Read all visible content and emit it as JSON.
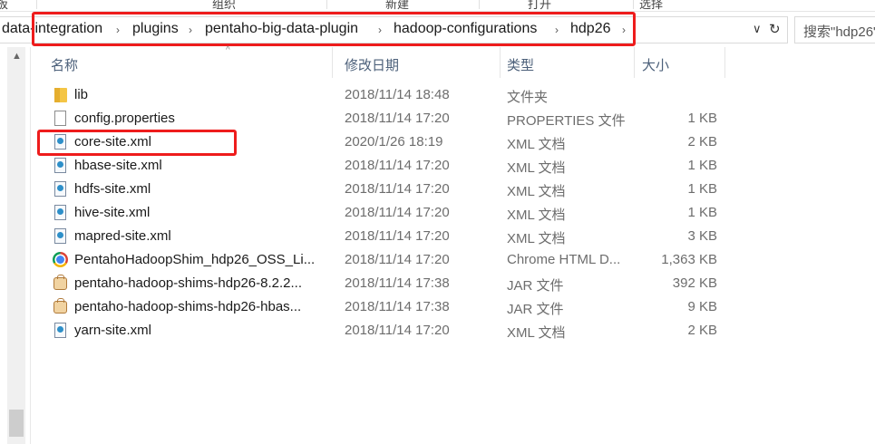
{
  "ribbon": {
    "groups": [
      "板",
      "组织",
      "新建",
      "打开",
      "选择"
    ]
  },
  "address_bar": {
    "breadcrumbs": [
      "data-integration",
      "plugins",
      "pentaho-big-data-plugin",
      "hadoop-configurations",
      "hdp26"
    ],
    "dropdown_icon": "chevron-down-icon",
    "refresh_icon": "refresh-icon"
  },
  "search": {
    "placeholder": "搜索\"hdp26\""
  },
  "columns": {
    "name": "名称",
    "date": "修改日期",
    "type": "类型",
    "size": "大小"
  },
  "files": [
    {
      "name": "lib",
      "date": "2018/11/14 18:48",
      "type": "文件夹",
      "size": "",
      "icon": "folder-icon"
    },
    {
      "name": "config.properties",
      "date": "2018/11/14 17:20",
      "type": "PROPERTIES 文件",
      "size": "1 KB",
      "icon": "document-icon"
    },
    {
      "name": "core-site.xml",
      "date": "2020/1/26 18:19",
      "type": "XML 文档",
      "size": "2 KB",
      "icon": "xml-file-icon"
    },
    {
      "name": "hbase-site.xml",
      "date": "2018/11/14 17:20",
      "type": "XML 文档",
      "size": "1 KB",
      "icon": "xml-file-icon"
    },
    {
      "name": "hdfs-site.xml",
      "date": "2018/11/14 17:20",
      "type": "XML 文档",
      "size": "1 KB",
      "icon": "xml-file-icon"
    },
    {
      "name": "hive-site.xml",
      "date": "2018/11/14 17:20",
      "type": "XML 文档",
      "size": "1 KB",
      "icon": "xml-file-icon"
    },
    {
      "name": "mapred-site.xml",
      "date": "2018/11/14 17:20",
      "type": "XML 文档",
      "size": "3 KB",
      "icon": "xml-file-icon"
    },
    {
      "name": "PentahoHadoopShim_hdp26_OSS_Li...",
      "date": "2018/11/14 17:20",
      "type": "Chrome HTML D...",
      "size": "1,363 KB",
      "icon": "chrome-icon"
    },
    {
      "name": "pentaho-hadoop-shims-hdp26-8.2.2...",
      "date": "2018/11/14 17:38",
      "type": "JAR 文件",
      "size": "392 KB",
      "icon": "jar-icon"
    },
    {
      "name": "pentaho-hadoop-shims-hdp26-hbas...",
      "date": "2018/11/14 17:38",
      "type": "JAR 文件",
      "size": "9 KB",
      "icon": "jar-icon"
    },
    {
      "name": "yarn-site.xml",
      "date": "2018/11/14 17:20",
      "type": "XML 文档",
      "size": "2 KB",
      "icon": "xml-file-icon"
    }
  ],
  "highlight_color": "#ee1c1c"
}
